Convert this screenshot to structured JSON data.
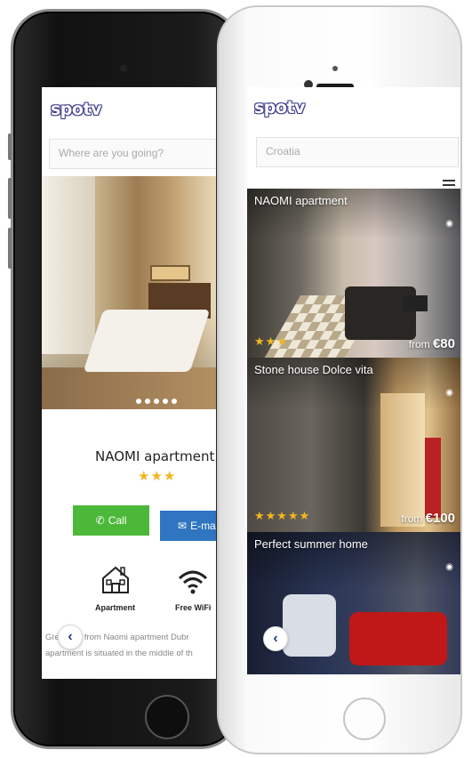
{
  "brand": {
    "logo_text": "spotv",
    "logo_color": "#3f3d8e"
  },
  "left_phone": {
    "search_placeholder": "Where are you going?",
    "hero_slide_dots": 5,
    "apartment_name": "NAOMI apartment",
    "rating_stars": "★★★",
    "call_label": "Call",
    "email_label": "E-mail",
    "amenities": [
      {
        "label": "Apartment",
        "icon": "house-icon"
      },
      {
        "label": "Free WiFi",
        "icon": "wifi-icon"
      }
    ],
    "description_line1": "Greetings from Naomi apartment Dubr",
    "description_line2": "apartment is situated in the middle of th",
    "back_glyph": "‹"
  },
  "right_phone": {
    "search_value": "Croatia",
    "listings": [
      {
        "title": "NAOMI apartment",
        "stars": "★★★",
        "price_prefix": "from",
        "price": "€80"
      },
      {
        "title": "Stone house Dolce vita",
        "stars": "★★★★★",
        "price_prefix": "from",
        "price": "€100"
      },
      {
        "title": "Perfect summer home",
        "stars": "",
        "price_prefix": "",
        "price": ""
      }
    ],
    "back_glyph": "‹"
  },
  "colors": {
    "call_button": "#4cb83a",
    "email_button": "#2f75c1",
    "star": "#f2b720"
  }
}
